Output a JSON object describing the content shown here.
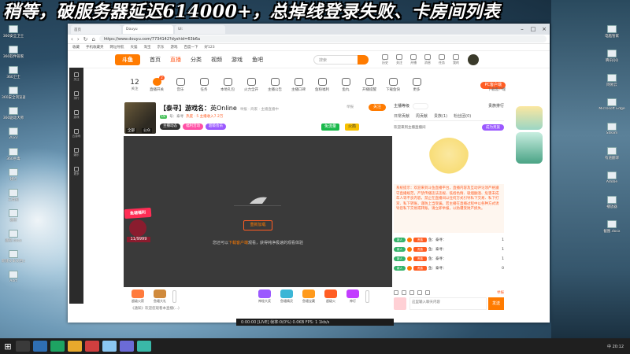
{
  "banner": "稍等，破服务器延迟614000+，总掉线登录失败、卡房间列表",
  "desktop": {
    "left_icons": [
      "360安全卫士",
      "360软件管家",
      "360卫士",
      "360安全浏览器",
      "360驱动大师",
      "2022",
      "360杀毒",
      "建行",
      "工具包",
      "遥控",
      "遥控.docx",
      "新建文本文档.txt",
      "Adrt"
    ],
    "right_icons": [
      "电脑管家",
      "腾讯QQ",
      "网易云",
      "Microsoft Edge",
      "Steam",
      "有道翻译",
      "Adobe",
      "播放器",
      "截图.docx"
    ]
  },
  "browser": {
    "tabs": [
      "首页",
      "Douyu",
      "UI:"
    ],
    "url": "https://www.douyu.com/7734142?dyshid=63b6a",
    "bookmarks": [
      "收藏",
      "手机收藏夹",
      "网址导航",
      "天猫",
      "淘宝",
      "京东",
      "游戏",
      "百度一下",
      "好123"
    ]
  },
  "topnav": {
    "logo": "斗鱼",
    "links": [
      "首页",
      "直播",
      "分类",
      "视频",
      "游戏",
      "鱼吧"
    ],
    "active": "直播",
    "search_placeholder": "搜索",
    "user_icons": [
      "历史",
      "关注",
      "开播",
      "消息",
      "任务",
      "我的"
    ]
  },
  "site_sidebar": [
    "关注",
    "排行",
    "游戏",
    "云游戏",
    "娱乐",
    "更多"
  ],
  "funcbar": {
    "follow_count": "12",
    "follow_label": "关注",
    "items": [
      {
        "label": "直播开关",
        "badge": "2",
        "icon": "toggle-icon"
      },
      {
        "label": "音乐",
        "icon": "wave-icon"
      },
      {
        "label": "任务",
        "icon": "task-icon"
      },
      {
        "label": "本地礼包",
        "icon": "gift-icon"
      },
      {
        "label": "火力全开",
        "icon": "fire-icon"
      },
      {
        "label": "主播公告",
        "icon": "cone-icon"
      },
      {
        "label": "主播口碑",
        "icon": "pin-icon"
      },
      {
        "label": "鱼粉福利",
        "icon": "fish-icon"
      },
      {
        "label": "鱼丸",
        "icon": "shield-icon"
      },
      {
        "label": "开播提醒",
        "icon": "clock-icon"
      },
      {
        "label": "下载鱼快",
        "icon": "cloud-icon"
      },
      {
        "label": "更多",
        "icon": "more-icon"
      }
    ],
    "pc_button": "PC客户端",
    "pc_sub": "下载客户端"
  },
  "room": {
    "title_bracket": "【泰寻】游戏名：",
    "title_name": "英Online",
    "title_extra": "举报 · 商家  · 主播直播中",
    "cover_labels": [
      "全部",
      "公众"
    ],
    "meta_level": "LV",
    "meta_text": "号：泰寻",
    "meta_hot": "热度 · 5  主播收入7.2万",
    "tags": [
      "主播动态",
      "福利活动",
      "超级会员"
    ],
    "report": "举报",
    "follow": "关注",
    "freeflow": "免流量",
    "fire": "火箭"
  },
  "player": {
    "button": "重新加载",
    "message_pre": "您还可以",
    "message_hl": "下载客户端",
    "message_post": "观看，获得纯净极速的观看体验"
  },
  "promo": {
    "title": "鱼塘福利",
    "count": "11/9999"
  },
  "gifts": [
    {
      "label": "超级火箭",
      "color": "#ff7b3d"
    },
    {
      "label": "鱼塘大礼",
      "color": "#d08a3c"
    },
    {
      "label": "神秘大奖",
      "color": "#9b59ff"
    },
    {
      "label": "鱼塘精灵",
      "color": "#3cb6d6"
    },
    {
      "label": "鱼塘宝藏",
      "color": "#ff9a1c"
    },
    {
      "label": "超级火",
      "color": "#ff5d23"
    },
    {
      "label": "神灯",
      "color": "#c23cff"
    }
  ],
  "bottom_line": "《通知》欢迎您观看本直播(...)",
  "chat": {
    "rank_label": "主播等级",
    "rank_right": "贵族排行",
    "tabs": [
      "日常贡献",
      "周贡献",
      "贵族(1)",
      "粉丝团(0)"
    ],
    "sub_left": "欢迎来到主播直播间",
    "sub_right": "成为贵族",
    "notice": "系统提示：欢迎来到斗鱼直播平台，直播内容及互动评论须严格遵守直播规范，严禁传播违法违规、低俗色情、吸烟酗酒、危害未成年人等不良内容，禁止在直播间以任何方式引导私下交易、私下打赏、私下转账，谨防上当受骗。若主播在直播过程中以各种方式诱导您私下交易或转账，请立即举报，以防遭受财产损失。",
    "messages": [
      {
        "badge": "新人",
        "level": "贵族",
        "text": "鱼：泰寻：",
        "value": "1"
      },
      {
        "badge": "新人",
        "level": "贵族",
        "text": "鱼：泰寻：",
        "value": "1"
      },
      {
        "badge": "新人",
        "level": "贵族",
        "text": "鱼：泰寻：",
        "value": "1"
      },
      {
        "badge": "新人",
        "level": "贵族",
        "text": "鱼：泰寻：",
        "value": "0"
      }
    ],
    "report": "举报",
    "input_placeholder": "这里输入聊天内容",
    "send": "发送"
  },
  "status_strip": "0:00:00 [LIVE]     帧率:0(0%)  0.0KB    FPS: 1    1kb/s",
  "taskbar": {
    "tray": "中  20:12"
  }
}
